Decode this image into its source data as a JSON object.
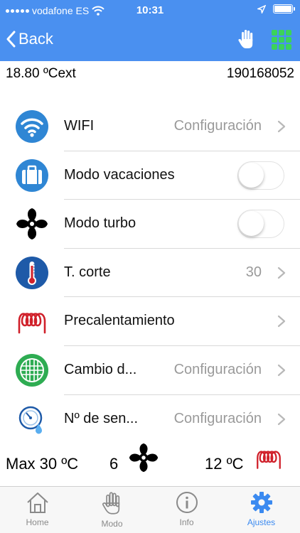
{
  "status_bar": {
    "carrier": "vodafone ES",
    "time": "10:31"
  },
  "nav": {
    "back_label": "Back"
  },
  "info_bar": {
    "outside_temp": "18.80 ºCext",
    "device_id": "190168052"
  },
  "settings": [
    {
      "label": "WIFI",
      "value": "Configuración",
      "icon": "wifi-icon",
      "control": "chevron"
    },
    {
      "label": "Modo vacaciones",
      "icon": "suitcase-icon",
      "control": "toggle",
      "on": false
    },
    {
      "label": "Modo turbo",
      "icon": "fan-icon",
      "control": "toggle",
      "on": false
    },
    {
      "label": "T. corte",
      "value": "30",
      "icon": "thermometer-icon",
      "control": "chevron"
    },
    {
      "label": "Precalentamiento",
      "icon": "heating-coil-icon",
      "control": "chevron"
    },
    {
      "label": "Cambio d...",
      "value": "Configuración",
      "icon": "filter-icon",
      "control": "chevron"
    },
    {
      "label": "Nº de sen...",
      "value": "Configuración",
      "icon": "sensor-icon",
      "control": "chevron"
    }
  ],
  "summary": {
    "max": "Max 30 ºC",
    "fan_value": "6",
    "temp": "12 ºC"
  },
  "tabs": [
    {
      "label": "Home",
      "icon": "home-icon",
      "active": false
    },
    {
      "label": "Modo",
      "icon": "hand-icon",
      "active": false
    },
    {
      "label": "Info",
      "icon": "info-icon",
      "active": false
    },
    {
      "label": "Ajustes",
      "icon": "gear-icon",
      "active": true
    }
  ],
  "colors": {
    "header": "#4a90f0",
    "accent": "#3b8af0",
    "grid_green": "#3bd35a",
    "coil_red": "#d0202a",
    "icon_blue": "#2f86d4",
    "filter_green": "#2eac52"
  }
}
